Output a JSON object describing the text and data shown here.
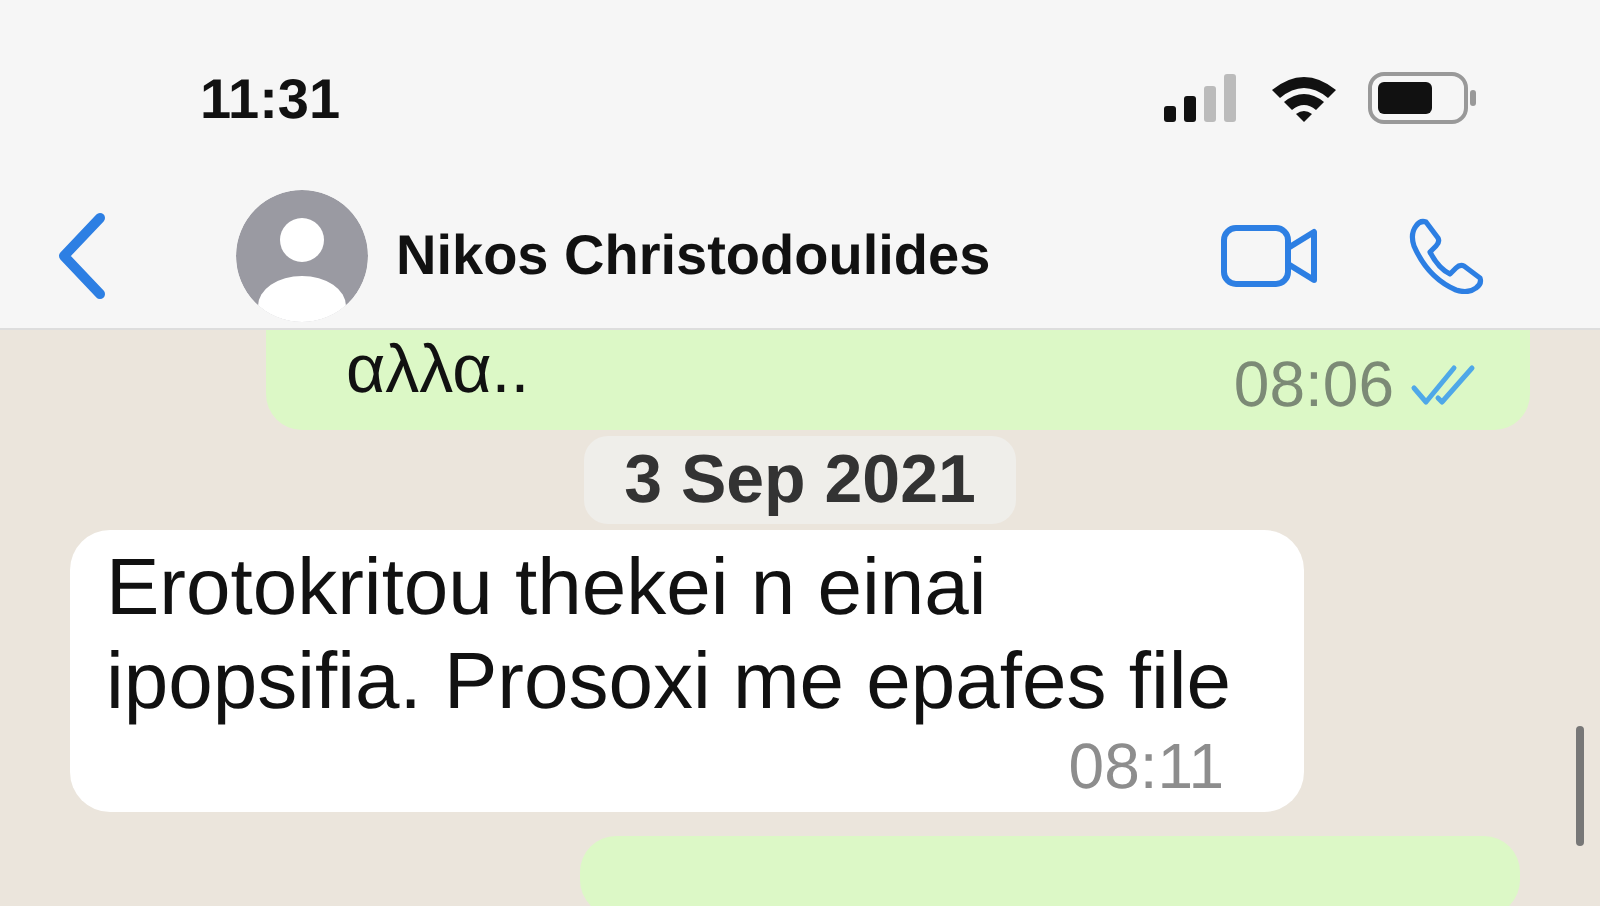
{
  "status_bar": {
    "time": "11:31"
  },
  "header": {
    "contact_name": "Nikos Christodoulides"
  },
  "messages": [
    {
      "kind": "outgoing",
      "text": "αλλα..",
      "time": "08:06",
      "read": true
    },
    {
      "kind": "date",
      "text": "3 Sep 2021"
    },
    {
      "kind": "incoming",
      "text": "Erotokritou thekei n einai ipopsifia. Prosoxi me epafes file",
      "time": "08:11"
    },
    {
      "kind": "outgoing_edge"
    }
  ]
}
